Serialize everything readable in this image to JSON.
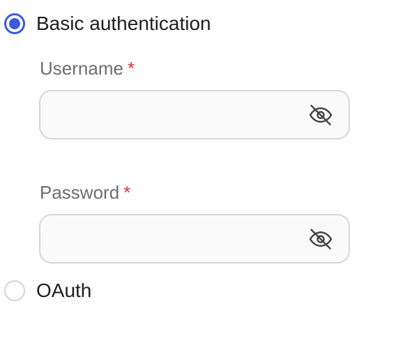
{
  "auth_options": {
    "basic": {
      "label": "Basic authentication",
      "selected": true
    },
    "oauth": {
      "label": "OAuth",
      "selected": false
    }
  },
  "username_field": {
    "label": "Username",
    "required_marker": "*",
    "value": "",
    "placeholder": "",
    "toggle_icon": "eye-off-icon"
  },
  "password_field": {
    "label": "Password",
    "required_marker": "*",
    "value": "",
    "placeholder": "",
    "toggle_icon": "eye-off-icon"
  },
  "colors": {
    "accent": "#3b5bdb",
    "required": "#d23b3b",
    "label": "#6e6e6e",
    "input_border": "#d7d7d7",
    "input_background": "#fafafa"
  }
}
